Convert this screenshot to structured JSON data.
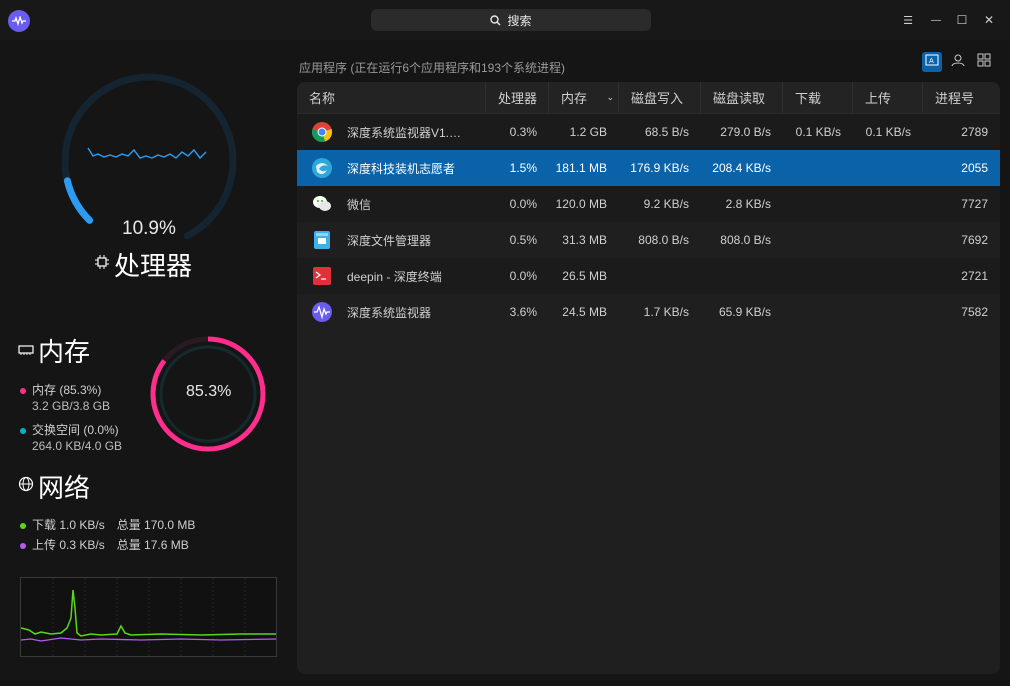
{
  "search": {
    "label": "搜索"
  },
  "window_controls": {
    "menu": "☰",
    "minimize": "—",
    "maximize": "☐",
    "close": "✕"
  },
  "cpu": {
    "title": "处理器",
    "percent": "10.9%",
    "value": 0.109
  },
  "memory": {
    "title": "内存",
    "percent": "85.3%",
    "value": 0.853,
    "mem_label": "内存 (85.3%)",
    "mem_detail": "3.2 GB/3.8 GB",
    "swap_label": "交换空间 (0.0%)",
    "swap_detail": "264.0 KB/4.0 GB",
    "mem_color": "#ff2d8c",
    "swap_color": "#00b4c8"
  },
  "network": {
    "title": "网络",
    "download": "下载 1.0 KB/s",
    "download_total": "总量 170.0 MB",
    "upload": "上传 0.3 KB/s",
    "upload_total": "总量 17.6 MB",
    "download_color": "#5cd61a",
    "upload_color": "#b65cf0"
  },
  "process_list": {
    "summary": "应用程序 (正在运行6个应用程序和193个系统进程)",
    "headers": {
      "name": "名称",
      "cpu": "处理器",
      "memory": "内存",
      "disk_write": "磁盘写入",
      "disk_read": "磁盘读取",
      "download": "下载",
      "upload": "上传",
      "pid": "进程号"
    },
    "rows": [
      {
        "icon": "chrome-icon",
        "name": "深度系统监视器V1.…",
        "cpu": "0.3%",
        "memory": "1.2 GB",
        "disk_write": "68.5 B/s",
        "disk_read": "279.0 B/s",
        "download": "0.1 KB/s",
        "upload": "0.1 KB/s",
        "pid": "2789"
      },
      {
        "icon": "deepin-installer-icon",
        "name": "深度科技装机志愿者",
        "cpu": "1.5%",
        "memory": "181.1 MB",
        "disk_write": "176.9 KB/s",
        "disk_read": "208.4 KB/s",
        "download": "",
        "upload": "",
        "pid": "2055"
      },
      {
        "icon": "wechat-icon",
        "name": "微信",
        "cpu": "0.0%",
        "memory": "120.0 MB",
        "disk_write": "9.2 KB/s",
        "disk_read": "2.8 KB/s",
        "download": "",
        "upload": "",
        "pid": "7727"
      },
      {
        "icon": "file-manager-icon",
        "name": "深度文件管理器",
        "cpu": "0.5%",
        "memory": "31.3 MB",
        "disk_write": "808.0 B/s",
        "disk_read": "808.0 B/s",
        "download": "",
        "upload": "",
        "pid": "7692"
      },
      {
        "icon": "terminal-icon",
        "name": "deepin - 深度终端",
        "cpu": "0.0%",
        "memory": "26.5 MB",
        "disk_write": "",
        "disk_read": "",
        "download": "",
        "upload": "",
        "pid": "2721"
      },
      {
        "icon": "system-monitor-icon",
        "name": "深度系统监视器",
        "cpu": "3.6%",
        "memory": "24.5 MB",
        "disk_write": "1.7 KB/s",
        "disk_read": "65.9 KB/s",
        "download": "",
        "upload": "",
        "pid": "7582"
      }
    ]
  },
  "colors": {
    "accent": "#0a63a8",
    "cpu_ring": "#2d9cf0",
    "background": "#151515"
  }
}
